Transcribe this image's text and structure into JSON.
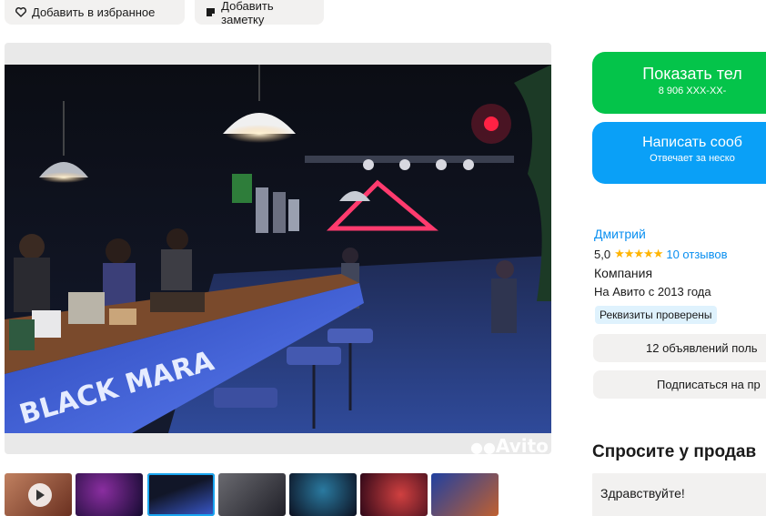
{
  "actions": {
    "favorite_label": "Добавить в избранное",
    "note_label": "Добавить заметку"
  },
  "gallery": {
    "watermark": "Avito",
    "sign_text": "BLACK MARA",
    "thumbnails": [
      {
        "kind": "video",
        "selected": false
      },
      {
        "kind": "photo",
        "selected": false
      },
      {
        "kind": "photo",
        "selected": true
      },
      {
        "kind": "photo",
        "selected": false
      },
      {
        "kind": "photo",
        "selected": false
      },
      {
        "kind": "photo",
        "selected": false
      },
      {
        "kind": "photo",
        "selected": false
      }
    ]
  },
  "contact": {
    "show_phone_label": "Показать тел",
    "phone_masked": "8 906 XXX-XX-",
    "message_label": "Написать сооб",
    "response_time": "Отвечает за неско"
  },
  "seller": {
    "name": "Дмитрий",
    "rating": "5,0",
    "stars": "★★★★★",
    "reviews": "10 отзывов",
    "type": "Компания",
    "since": "На Авито с 2013 года",
    "verified_badge": "Реквизиты проверены",
    "listings_button": "12 объявлений поль",
    "subscribe_button": "Подписаться на пр"
  },
  "ask": {
    "title": "Спросите у продав",
    "message": "Здравствуйте!"
  },
  "colors": {
    "green": "#04c44a",
    "blue": "#0aa0f7",
    "link": "#0a8ff0",
    "star": "#ffb400",
    "neutral": "#f2f1f0"
  },
  "icons": {
    "favorite": "heart-outline-icon",
    "note": "note-icon",
    "video": "play-icon",
    "watermark": "avito-logo-icon"
  }
}
